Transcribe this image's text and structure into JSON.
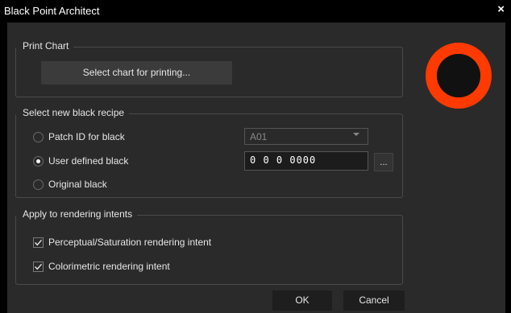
{
  "window": {
    "title": "Black Point Architect",
    "close_glyph": "×"
  },
  "print_chart": {
    "label": "Print Chart",
    "select_button": "Select chart for printing..."
  },
  "recipe": {
    "label": "Select new black recipe",
    "options": [
      {
        "label": "Patch ID for black",
        "checked": false
      },
      {
        "label": "User defined black",
        "checked": true
      },
      {
        "label": "Original black",
        "checked": false
      }
    ],
    "patch_select_value": "A01",
    "user_value": "0 0 0 0000",
    "browse_button": "..."
  },
  "intents": {
    "label": "Apply to rendering intents",
    "items": [
      {
        "label": "Perceptual/Saturation rendering intent",
        "checked": true
      },
      {
        "label": "Colorimetric rendering intent",
        "checked": true
      }
    ]
  },
  "footer": {
    "ok": "OK",
    "cancel": "Cancel"
  },
  "indicator": {
    "ring_color": "#ff3a00",
    "center_color": "#111111",
    "icon": "black-point-indicator-icon"
  }
}
